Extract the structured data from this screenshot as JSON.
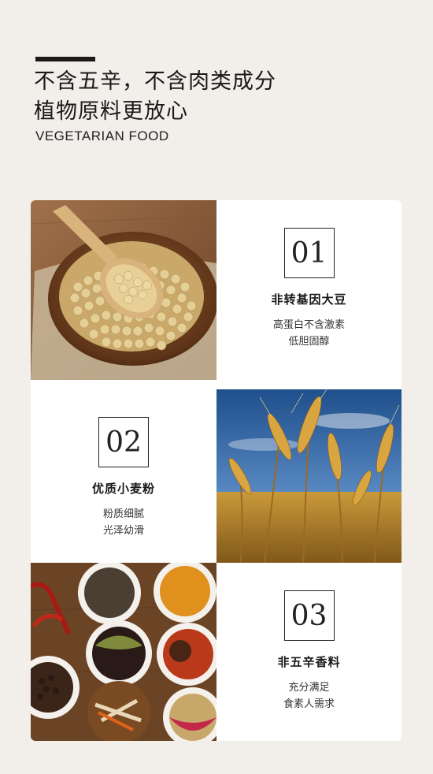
{
  "header": {
    "title_line1": "不含五辛，不含肉类成分",
    "title_line2": "植物原料更放心",
    "subtitle": "VEGETARIAN FOOD"
  },
  "features": [
    {
      "number": "01",
      "title": "非转基因大豆",
      "line1": "高蛋白不含激素",
      "line2": "低胆固醇"
    },
    {
      "number": "02",
      "title": "优质小麦粉",
      "line1": "粉质细腻",
      "line2": "光泽幼滑"
    },
    {
      "number": "03",
      "title": "非五辛香料",
      "line1": "充分满足",
      "line2": "食素人需求"
    }
  ],
  "images": [
    {
      "name": "soybeans-photo"
    },
    {
      "name": "wheat-field-photo"
    },
    {
      "name": "spices-photo"
    }
  ]
}
